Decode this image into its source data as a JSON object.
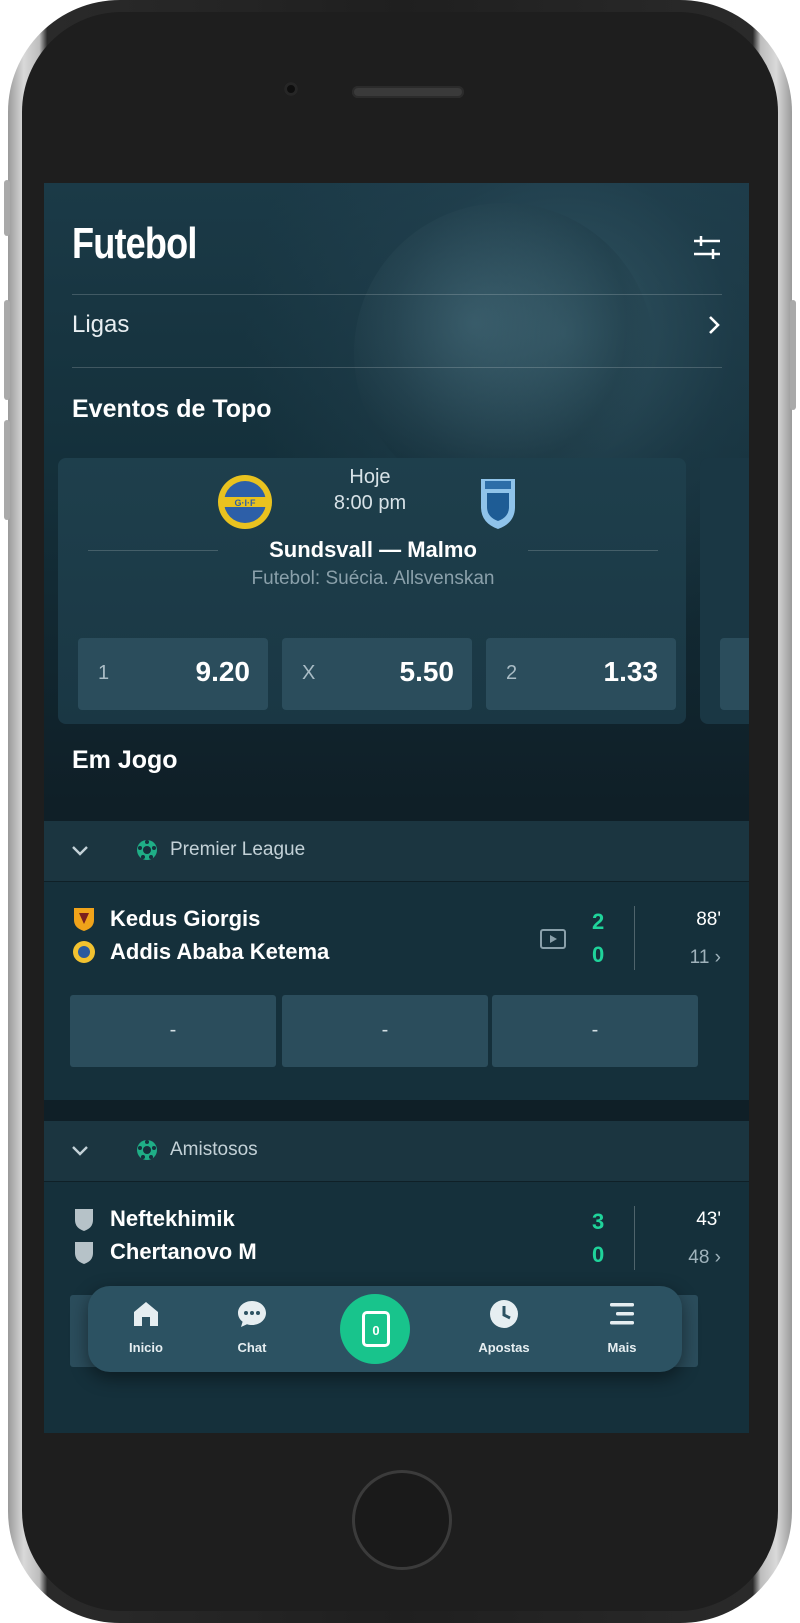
{
  "header": {
    "title": "Futebol",
    "filter_icon": "filter-sliders-icon"
  },
  "ligas": {
    "label": "Ligas",
    "icon": "chevron-right-icon"
  },
  "top_events": {
    "section_title": "Eventos de Topo",
    "event": {
      "day": "Hoje",
      "time": "8:00 pm",
      "home_logo_text": "G·I·F",
      "match": "Sundsvall — Malmo",
      "league": "Futebol: Suécia. Allsvenskan",
      "odds": [
        {
          "label": "1",
          "value": "9.20"
        },
        {
          "label": "X",
          "value": "5.50"
        },
        {
          "label": "2",
          "value": "1.33"
        }
      ]
    }
  },
  "in_play": {
    "section_title": "Em Jogo",
    "leagues": [
      {
        "name": "Premier League",
        "match": {
          "home": "Kedus Giorgis",
          "away": "Addis Ababa Ketema",
          "home_score": "2",
          "away_score": "0",
          "minute": "88'",
          "more_markets": "11",
          "odds": [
            "-",
            "-",
            "-"
          ]
        }
      },
      {
        "name": "Amistosos",
        "match": {
          "home": "Neftekhimik",
          "away": "Chertanovo M",
          "home_score": "3",
          "away_score": "0",
          "minute": "43'",
          "more_markets": "48",
          "odds": [
            "",
            "",
            ""
          ]
        }
      }
    ]
  },
  "nav": {
    "home": "Inicio",
    "chat": "Chat",
    "betslip_count": "0",
    "bets": "Apostas",
    "more": "Mais"
  },
  "colors": {
    "accent_green": "#1fd39a",
    "betslip_green": "#18c48c",
    "card_bg": "#1e3f4c",
    "odd_button_bg": "#2b4d5c",
    "nav_bg": "#2c5262"
  }
}
